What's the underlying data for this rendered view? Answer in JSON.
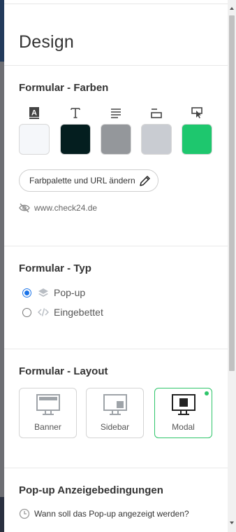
{
  "panel": {
    "title": "Design"
  },
  "colors_section": {
    "title": "Formular - Farben",
    "swatches": [
      {
        "icon": "text-background-icon",
        "color": "#f5f7fa"
      },
      {
        "icon": "text-color-icon",
        "color": "#041e1f"
      },
      {
        "icon": "paragraph-lines-icon",
        "color": "#94979b"
      },
      {
        "icon": "input-field-icon",
        "color": "#c9ccd2"
      },
      {
        "icon": "button-cursor-icon",
        "color": "#1ec76e"
      }
    ],
    "palette_button_label": "Farbpalette und URL ändern",
    "url": "www.check24.de"
  },
  "type_section": {
    "title": "Formular - Typ",
    "options": [
      {
        "label": "Pop-up",
        "icon": "layers-icon",
        "checked": true
      },
      {
        "label": "Eingebettet",
        "icon": "code-icon",
        "checked": false
      }
    ]
  },
  "layout_section": {
    "title": "Formular - Layout",
    "options": [
      {
        "label": "Banner",
        "icon": "banner-layout-icon",
        "selected": false
      },
      {
        "label": "Sidebar",
        "icon": "sidebar-layout-icon",
        "selected": false
      },
      {
        "label": "Modal",
        "icon": "modal-layout-icon",
        "selected": true
      }
    ]
  },
  "conditions_section": {
    "title": "Pop-up Anzeigebedingungen",
    "question": "Wann soll das Pop-up angezeigt werden?"
  },
  "accent_colors": {
    "selected_green": "#2ec56a",
    "radio_blue": "#1a73e8"
  }
}
